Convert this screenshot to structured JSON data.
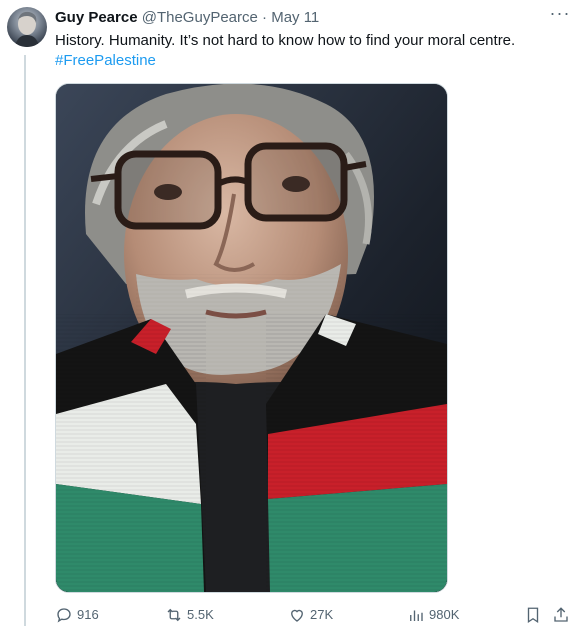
{
  "tweet": {
    "author_name": "Guy Pearce",
    "handle": "@TheGuyPearce",
    "separator": "·",
    "date": "May 11",
    "text": "History. Humanity. It’s not hard to know how to find your moral centre.",
    "hashtag": "#FreePalestine",
    "more_label": "···"
  },
  "actions": {
    "replies": "916",
    "reposts": "5.5K",
    "likes": "27K",
    "views": "980K"
  },
  "colors": {
    "link": "#1d9bf0",
    "secondary_text": "#536471",
    "scarf_red": "#c8202a",
    "scarf_green": "#2f8a6a",
    "scarf_white": "#e9ece8",
    "scarf_black": "#141414"
  },
  "icons": [
    "reply-icon",
    "repost-icon",
    "like-icon",
    "views-icon",
    "bookmark-icon",
    "share-icon",
    "more-icon"
  ]
}
